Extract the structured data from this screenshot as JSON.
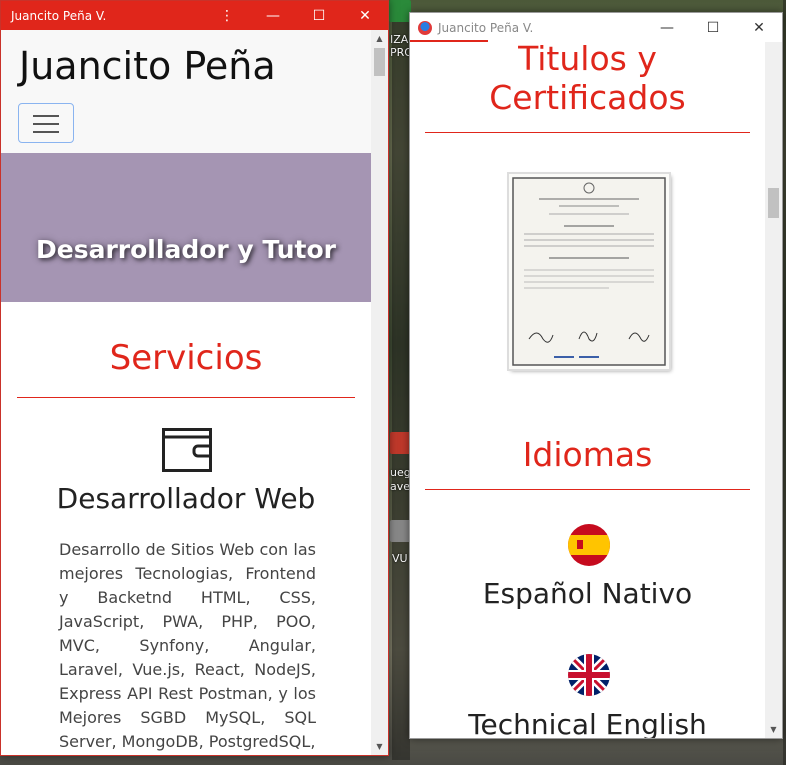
{
  "window_left": {
    "title": "Juancito Peña V.",
    "brand": "Juancito Peña",
    "hero_text": "Desarrollador y Tutor",
    "section_title": "Servicios",
    "service": {
      "title": "Desarrollador Web",
      "description": "Desarrollo de Sitios Web con las mejores Tecnologias, Frontend y Backetnd HTML, CSS, JavaScript, PWA, PHP, POO, MVC, Synfony, Angular, Laravel, Vue.js, React, NodeJS, Express API Rest Postman, y los Mejores SGBD MySQL, SQL Server, MongoDB, PostgredSQL,"
    }
  },
  "window_right": {
    "title": "Juancito Peña V.",
    "section_certificates_line1": "Titulos y",
    "section_certificates_line2": "Certificados",
    "section_languages": "Idiomas",
    "languages": [
      "Español Nativo",
      "Technical English"
    ]
  },
  "desktop": {
    "labels": [
      "IZA",
      "PRO",
      "uego",
      "aves",
      "VU"
    ]
  },
  "colors": {
    "accent": "#e0261b",
    "hero_bg": "#a595b3"
  }
}
